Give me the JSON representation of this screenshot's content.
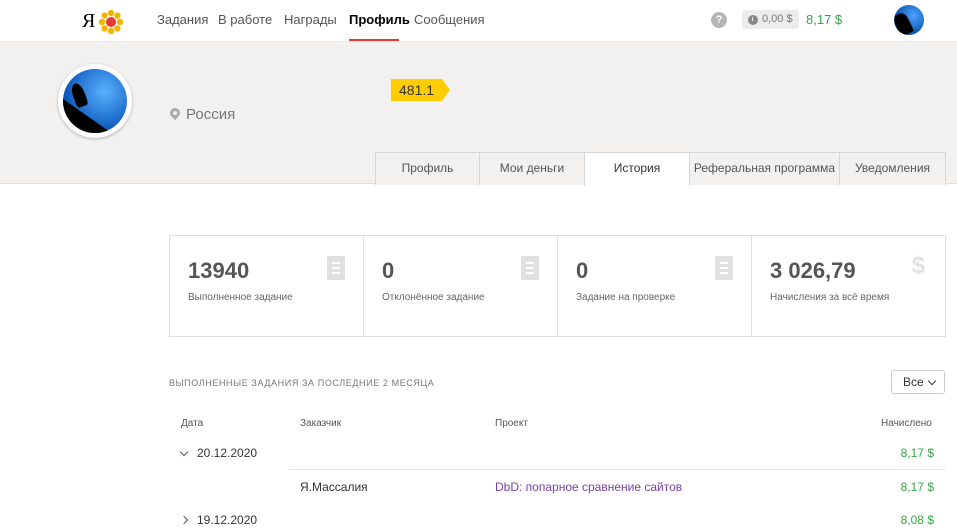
{
  "nav": {
    "logo_text": "Я",
    "links": [
      "Задания",
      "В работе",
      "Награды",
      "Профиль",
      "Сообщения"
    ],
    "help": "?",
    "pending": "0,00 $",
    "balance": "8,17 $"
  },
  "profile": {
    "rating": "481.1",
    "location": "Россия",
    "tabs": [
      "Профиль",
      "Мои деньги",
      "История",
      "Реферальная программа",
      "Уведомления"
    ],
    "active_tab": "История"
  },
  "stats": [
    {
      "value": "13940",
      "label": "Выполненное задание",
      "icon": "document-icon"
    },
    {
      "value": "0",
      "label": "Отклонённое задание",
      "icon": "document-icon"
    },
    {
      "value": "0",
      "label": "Задание на проверке",
      "icon": "document-icon"
    },
    {
      "value": "3 026,79",
      "label": "Начисления за всё время",
      "icon": "dollar-icon"
    }
  ],
  "history": {
    "title": "ВЫПОЛНЕННЫЕ ЗАДАНИЯ ЗА ПОСЛЕДНИЕ 2 МЕСЯЦА",
    "filter": "Все",
    "columns": {
      "date": "Дата",
      "customer": "Заказчик",
      "project": "Проект",
      "amount": "Начислено"
    },
    "groups": [
      {
        "date": "20.12.2020",
        "amount": "8,17 $",
        "expanded": true,
        "rows": [
          {
            "customer": "Я.Массалия",
            "project": "DbD: попарное сравнение сайтов",
            "amount": "8,17 $"
          }
        ]
      },
      {
        "date": "19.12.2020",
        "amount": "8,08 $",
        "expanded": false,
        "rows": []
      }
    ]
  },
  "colors": {
    "accent": "#e53935",
    "money": "#3aa34a",
    "rating": "#ffcc00",
    "link": "#7b3fa0"
  }
}
